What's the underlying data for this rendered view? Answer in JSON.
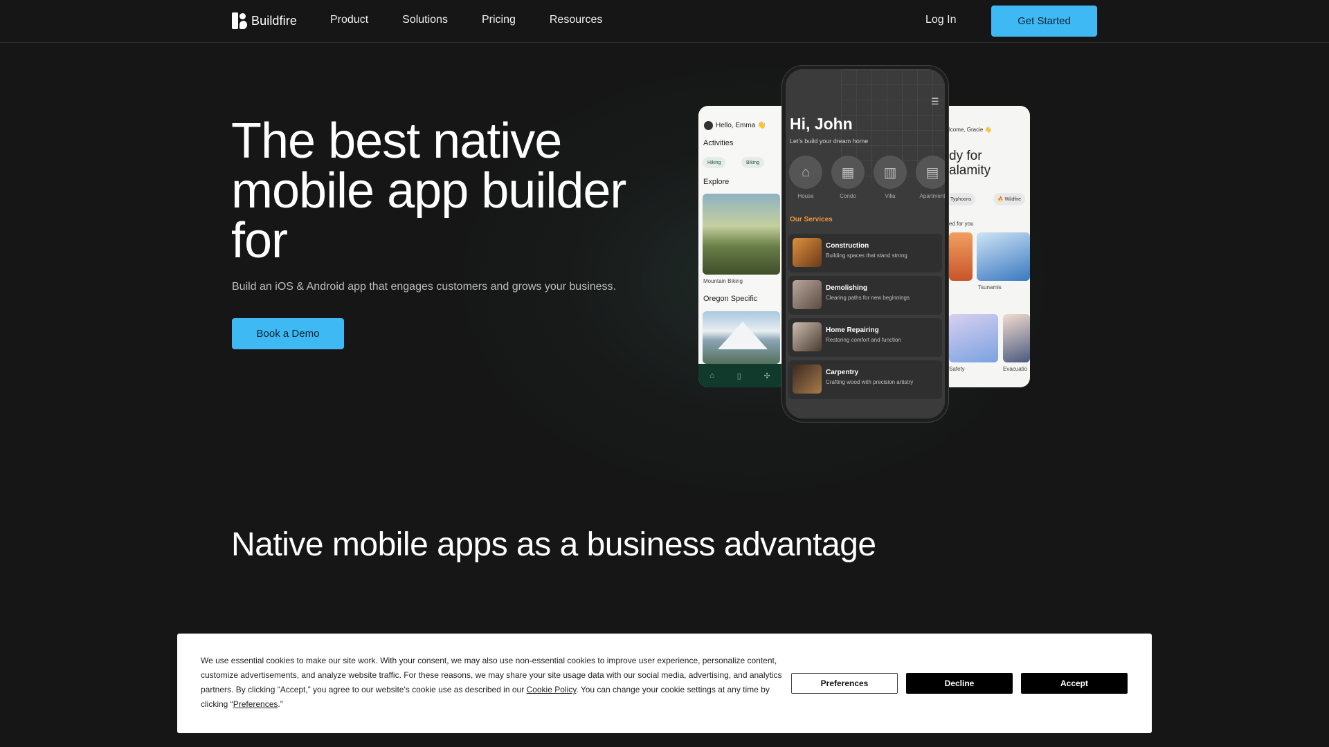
{
  "nav": {
    "logo": "Buildfire",
    "links": [
      "Product",
      "Solutions",
      "Pricing",
      "Resources"
    ],
    "login": "Log In",
    "cta": "Get Started"
  },
  "hero": {
    "title_line1": "The best native",
    "title_line2": "mobile app builder",
    "title_line3": "for",
    "subtitle": "Build an iOS & Android app that engages customers and grows your business.",
    "cta": "Book a Demo"
  },
  "section": {
    "title": "Native mobile apps as a business advantage"
  },
  "phone_left": {
    "greeting": "Hello, Emma 👋",
    "activities": "Activities",
    "chips": [
      "Hiking",
      "Biking"
    ],
    "explore": "Explore",
    "caption": "Mountain Biking",
    "oregon": "Oregon Specific"
  },
  "phone_center": {
    "title": "Hi, John",
    "subtitle": "Let's build your dream home",
    "categories": [
      "House",
      "Condo",
      "Villa",
      "Apartment"
    ],
    "services_heading": "Our Services",
    "services": [
      {
        "title": "Construction",
        "desc": "Building spaces that stand strong"
      },
      {
        "title": "Demolishing",
        "desc": "Clearing paths for new beginnings"
      },
      {
        "title": "Home Repairing",
        "desc": "Restoring comfort and function"
      },
      {
        "title": "Carpentry",
        "desc": "Crafting wood with precision artistry"
      }
    ]
  },
  "phone_right": {
    "welcome": "lcome, Gracie 👋",
    "heading_line1": "dy for",
    "heading_line2": "alamity",
    "chips": [
      "Typhoons",
      "🔥 Wildfire"
    ],
    "curated": "ed for you",
    "captions": [
      "Tsunamis",
      "Safety",
      "Evacuatio"
    ]
  },
  "cookie": {
    "text_before": "We use essential cookies to make our site work. With your consent, we may also use non-essential cookies to improve user experience, personalize content, customize advertisements, and analyze website traffic. For these reasons, we may share your site usage data with our social media, advertising, and analytics partners. By clicking “Accept,” you agree to our website's cookie use as described in our ",
    "policy_link": "Cookie Policy",
    "text_middle": ". You can change your cookie settings at any time by clicking “",
    "pref_link": "Preferences",
    "text_end": ".”",
    "buttons": {
      "preferences": "Preferences",
      "decline": "Decline",
      "accept": "Accept"
    }
  },
  "colors": {
    "accent": "#3fb9f3",
    "background": "#161616",
    "services_orange": "#f0973a"
  }
}
